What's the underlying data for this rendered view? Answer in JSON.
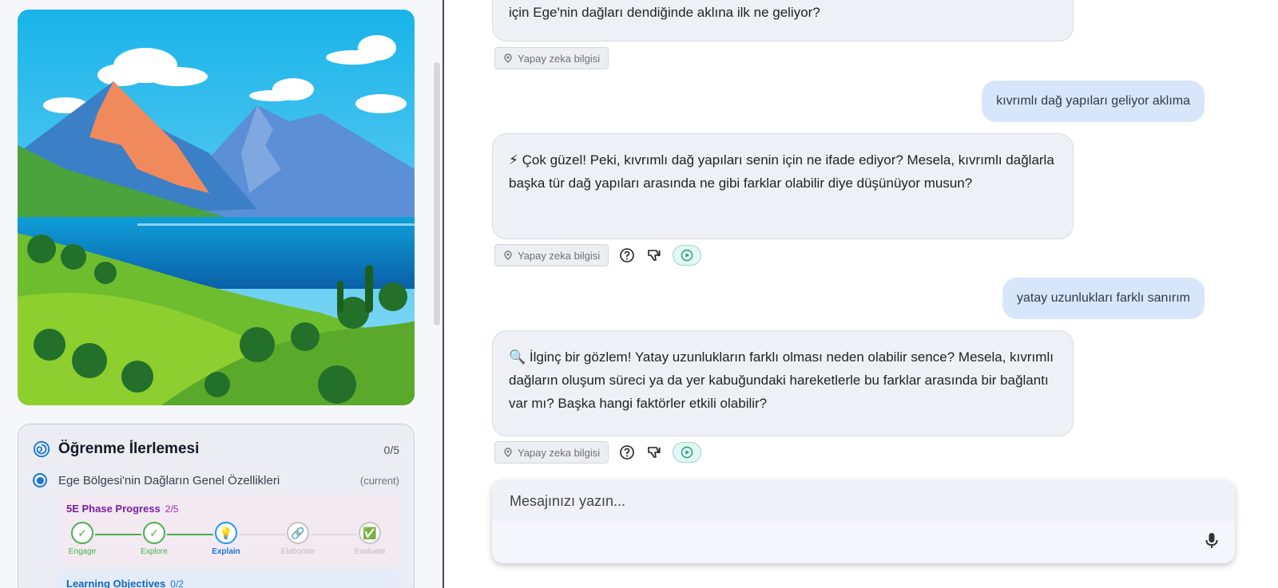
{
  "left_panel": {
    "progress": {
      "title": "Öğrenme İlerlemesi",
      "count": "0/5",
      "topic": {
        "label": "Ege Bölgesi'nin Dağların Genel Özellikleri",
        "tag": "(current)"
      },
      "phase": {
        "title": "5E Phase Progress",
        "count": "2/5",
        "steps": [
          {
            "label": "Engage",
            "state": "done",
            "icon": "check-icon"
          },
          {
            "label": "Explore",
            "state": "done",
            "icon": "check-icon"
          },
          {
            "label": "Explain",
            "state": "current",
            "icon": "lightbulb-icon"
          },
          {
            "label": "Elaborate",
            "state": "pending",
            "icon": "link-icon"
          },
          {
            "label": "Evaluate",
            "state": "pending",
            "icon": "checkbox-icon"
          }
        ]
      },
      "objectives": {
        "title": "Learning Objectives",
        "count": "0/2"
      }
    }
  },
  "chat": {
    "messages": [
      {
        "role": "ai",
        "text": "için Ege'nin dağları dendiğinde aklına ilk ne geliyor?",
        "chip": "Yapay zeka bilgisi"
      },
      {
        "role": "user",
        "text": "kıvrımlı dağ yapıları geliyor aklıma"
      },
      {
        "role": "ai",
        "text": "⚡ Çok güzel! Peki, kıvrımlı dağ yapıları senin için ne ifade ediyor? Mesela, kıvrımlı dağlarla başka tür dağ yapıları arasında ne gibi farklar olabilir diye düşünüyor musun?",
        "chip": "Yapay zeka bilgisi"
      },
      {
        "role": "user",
        "text": "yatay uzunlukları farklı sanırım"
      },
      {
        "role": "ai",
        "text": "🔍 İlginç bir gözlem! Yatay uzunlukların farklı olması neden olabilir sence? Mesela, kıvrımlı dağların oluşum süreci ya da yer kabuğundaki hareketlerle bu farklar arasında bir bağlantı var mı? Başka hangi faktörler etkili olabilir?",
        "chip": "Yapay zeka bilgisi"
      }
    ],
    "composer": {
      "placeholder": "Mesajınızı yazın..."
    }
  },
  "colors": {
    "accent": "#1976d2",
    "success": "#4caf50",
    "phase": "#7b1fa2",
    "user_bubble": "#d7e6fb",
    "ai_bubble": "#eef0f6"
  }
}
